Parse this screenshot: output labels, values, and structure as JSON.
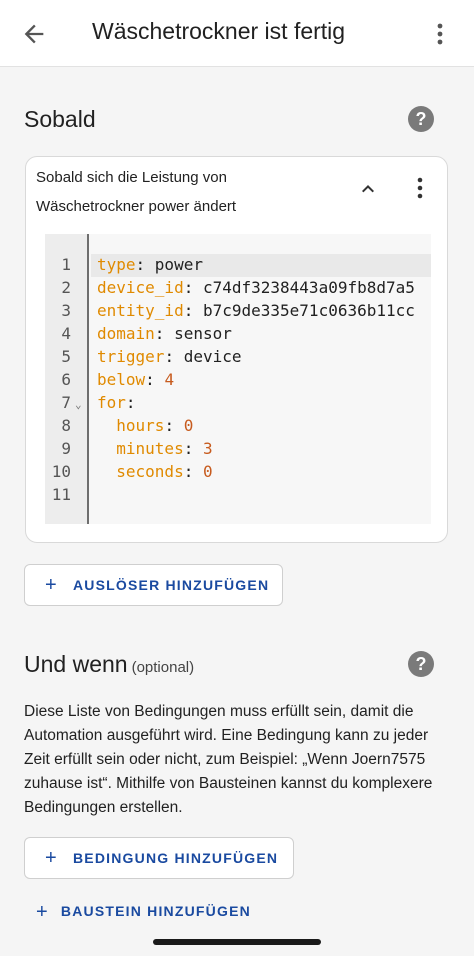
{
  "appbar": {
    "back_icon": "arrow-left-icon",
    "title": "Wäschetrockner ist fertig",
    "menu_icon": "more-vertical-icon"
  },
  "trigger_section": {
    "title": "Sobald",
    "help_icon": "help-circle-icon",
    "card": {
      "title_line1": "Sobald sich die Leistung von",
      "title_line2": "Wäschetrockner power ändert",
      "collapse_icon": "chevron-up-icon",
      "menu_icon": "more-vertical-icon"
    },
    "code": {
      "line_numbers": [
        "1",
        "2",
        "3",
        "4",
        "5",
        "6",
        "7",
        "8",
        "9",
        "10",
        "11"
      ],
      "fold_marker": "⌄",
      "lines": [
        {
          "indent": "",
          "key": "type",
          "sep": ": ",
          "value": "power",
          "value_type": "text"
        },
        {
          "indent": "",
          "key": "device_id",
          "sep": ": ",
          "value": "c74df3238443a09fb8d7a5",
          "value_type": "text"
        },
        {
          "indent": "",
          "key": "entity_id",
          "sep": ": ",
          "value": "b7c9de335e71c0636b11cc",
          "value_type": "text"
        },
        {
          "indent": "",
          "key": "domain",
          "sep": ": ",
          "value": "sensor",
          "value_type": "text"
        },
        {
          "indent": "",
          "key": "trigger",
          "sep": ": ",
          "value": "device",
          "value_type": "text"
        },
        {
          "indent": "",
          "key": "below",
          "sep": ": ",
          "value": "4",
          "value_type": "number"
        },
        {
          "indent": "",
          "key": "for",
          "sep": ":",
          "value": "",
          "value_type": "text"
        },
        {
          "indent": "  ",
          "key": "hours",
          "sep": ": ",
          "value": "0",
          "value_type": "number"
        },
        {
          "indent": "  ",
          "key": "minutes",
          "sep": ": ",
          "value": "3",
          "value_type": "number"
        },
        {
          "indent": "  ",
          "key": "seconds",
          "sep": ": ",
          "value": "0",
          "value_type": "number"
        }
      ]
    },
    "add_button": {
      "plus": "+",
      "label": "AUSLÖSER HINZUFÜGEN"
    }
  },
  "condition_section": {
    "title": "Und wenn",
    "optional": "(optional)",
    "help_icon": "help-circle-icon",
    "description": "Diese Liste von Bedingungen muss erfüllt sein, damit die Automation ausgeführt wird. Eine Bedingung kann zu jeder Zeit erfüllt sein oder nicht, zum Beispiel: „Wenn Joern7575 zuhause ist“. Mithilfe von Bausteinen kannst du komplexere Bedingungen erstellen.",
    "add_button": {
      "plus": "+",
      "label": "BEDINGUNG HINZUFÜGEN"
    },
    "building_block_button": {
      "plus": "+",
      "label": "BAUSTEIN HINZUFÜGEN"
    }
  },
  "colors": {
    "accent": "#1a4aa0",
    "yaml_key": "#e08a00",
    "yaml_number": "#c75b1e",
    "background": "#f5f5f5"
  }
}
